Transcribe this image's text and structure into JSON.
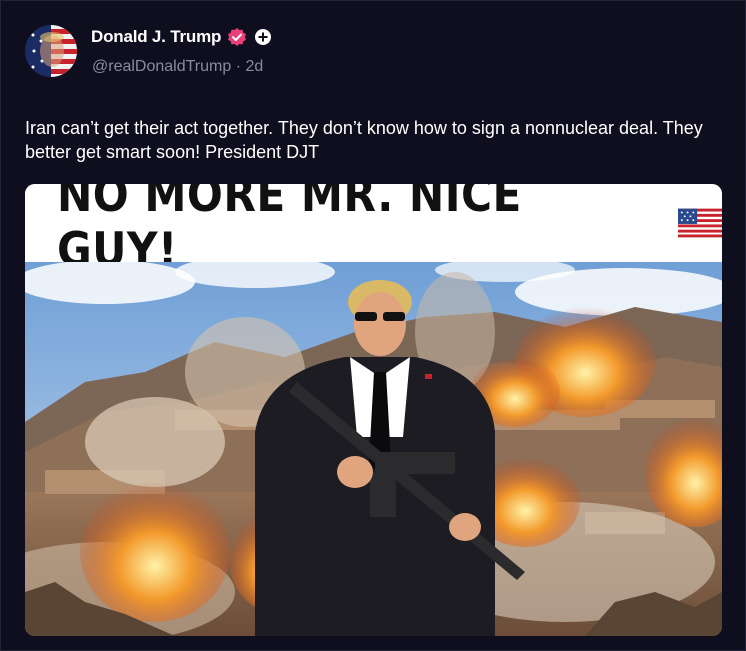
{
  "post": {
    "author": {
      "display_name": "Donald J. Trump",
      "handle": "@realDonaldTrump",
      "separator": "·",
      "age": "2d",
      "verified_icon": "verified-check-icon",
      "plus_icon": "plus-badge-icon"
    },
    "text": "Iran can’t get their act together. They don’t know how to sign a nonnuclear deal. They better get smart soon! President DJT",
    "media": {
      "headline": "NO MORE MR. NICE GUY!",
      "headline_icon": "us-flag-icon"
    }
  },
  "colors": {
    "background": "#0f0e1f",
    "text_primary": "#ffffff",
    "text_secondary": "#8c8aa3",
    "verified_badge": "#e8417a"
  }
}
